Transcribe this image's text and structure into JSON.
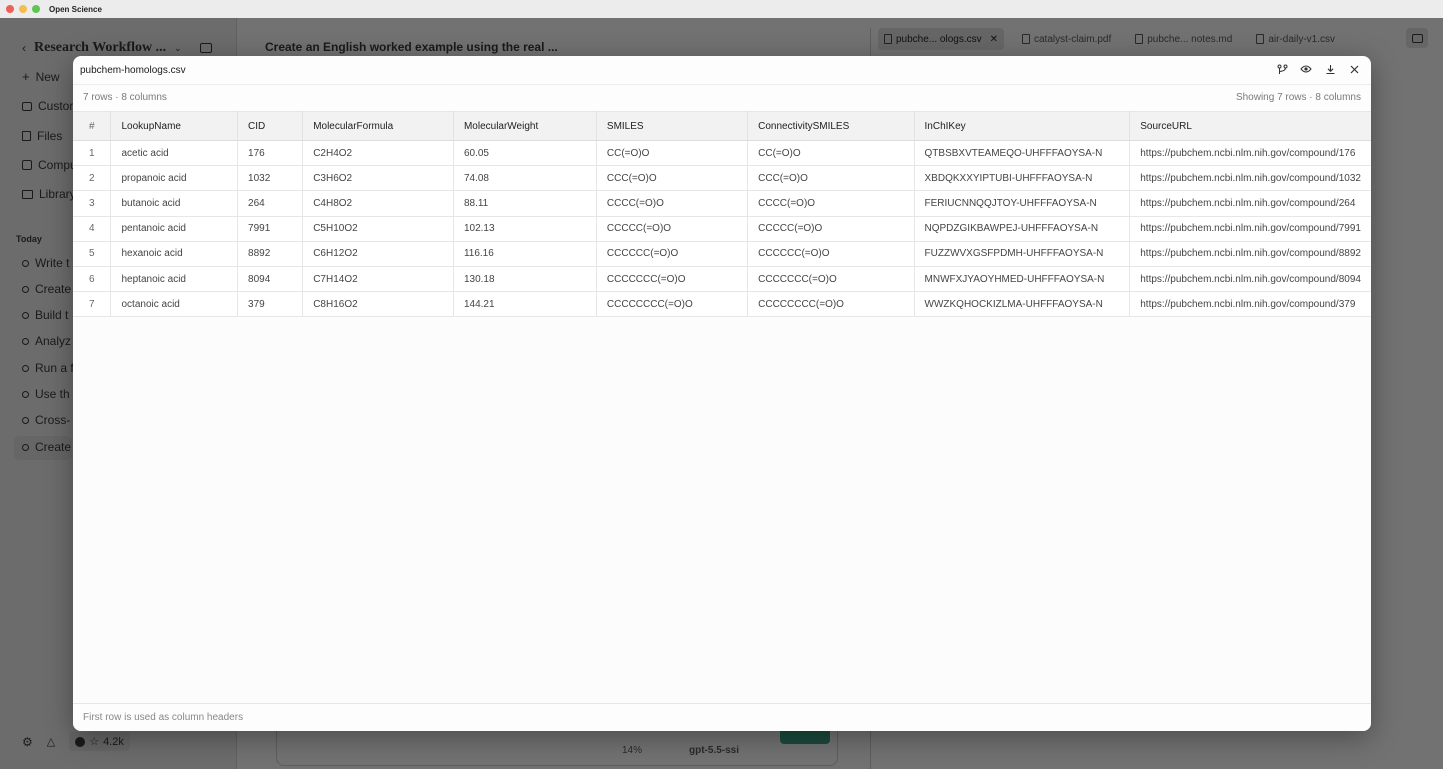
{
  "window": {
    "title": "Open Science"
  },
  "sidebar": {
    "workspace_title": "Research Workflow ...",
    "new_label": "New",
    "nav": [
      {
        "label": "Custom",
        "icon": "briefcase-icon"
      },
      {
        "label": "Files",
        "icon": "files-icon"
      },
      {
        "label": "Compu",
        "icon": "compute-icon"
      },
      {
        "label": "Library",
        "icon": "book-icon"
      }
    ],
    "section_today": "Today",
    "history": [
      "Write t",
      "Create",
      "Build t",
      "Analyz",
      "Run a f",
      "Use th",
      "Cross-",
      "Create"
    ],
    "stars": "4.2k"
  },
  "chat": {
    "title": "Create an English worked example using the real ...",
    "composer_meta": "14%",
    "model_label": "gpt-5.5-ssi"
  },
  "tabs": [
    {
      "label": "pubche... ologs.csv",
      "active": true
    },
    {
      "label": "catalyst-claim.pdf",
      "active": false
    },
    {
      "label": "pubche... notes.md",
      "active": false
    },
    {
      "label": "air-daily-v1.csv",
      "active": false
    }
  ],
  "modal": {
    "title": "pubchem-homologs.csv",
    "summary_left": "7 rows · 8 columns",
    "summary_right": "Showing 7 rows · 8 columns",
    "footer": "First row is used as column headers",
    "columns": [
      "#",
      "LookupName",
      "CID",
      "MolecularFormula",
      "MolecularWeight",
      "SMILES",
      "ConnectivitySMILES",
      "InChIKey",
      "SourceURL"
    ],
    "rows": [
      [
        "1",
        "acetic acid",
        "176",
        "C2H4O2",
        "60.05",
        "CC(=O)O",
        "CC(=O)O",
        "QTBSBXVTEAMEQO-UHFFFAOYSA-N",
        "https://pubchem.ncbi.nlm.nih.gov/compound/176"
      ],
      [
        "2",
        "propanoic acid",
        "1032",
        "C3H6O2",
        "74.08",
        "CCC(=O)O",
        "CCC(=O)O",
        "XBDQKXXYIPTUBI-UHFFFAOYSA-N",
        "https://pubchem.ncbi.nlm.nih.gov/compound/1032"
      ],
      [
        "3",
        "butanoic acid",
        "264",
        "C4H8O2",
        "88.11",
        "CCCC(=O)O",
        "CCCC(=O)O",
        "FERIUCNNQQJTOY-UHFFFAOYSA-N",
        "https://pubchem.ncbi.nlm.nih.gov/compound/264"
      ],
      [
        "4",
        "pentanoic acid",
        "7991",
        "C5H10O2",
        "102.13",
        "CCCCC(=O)O",
        "CCCCC(=O)O",
        "NQPDZGIKBAWPEJ-UHFFFAOYSA-N",
        "https://pubchem.ncbi.nlm.nih.gov/compound/7991"
      ],
      [
        "5",
        "hexanoic acid",
        "8892",
        "C6H12O2",
        "116.16",
        "CCCCCC(=O)O",
        "CCCCCC(=O)O",
        "FUZZWVXGSFPDMH-UHFFFAOYSA-N",
        "https://pubchem.ncbi.nlm.nih.gov/compound/8892"
      ],
      [
        "6",
        "heptanoic acid",
        "8094",
        "C7H14O2",
        "130.18",
        "CCCCCCC(=O)O",
        "CCCCCCC(=O)O",
        "MNWFXJYAOYHMED-UHFFFAOYSA-N",
        "https://pubchem.ncbi.nlm.nih.gov/compound/8094"
      ],
      [
        "7",
        "octanoic acid",
        "379",
        "C8H16O2",
        "144.21",
        "CCCCCCCC(=O)O",
        "CCCCCCCC(=O)O",
        "WWZKQHOCKIZLMA-UHFFFAOYSA-N",
        "https://pubchem.ncbi.nlm.nih.gov/compound/379"
      ]
    ]
  }
}
